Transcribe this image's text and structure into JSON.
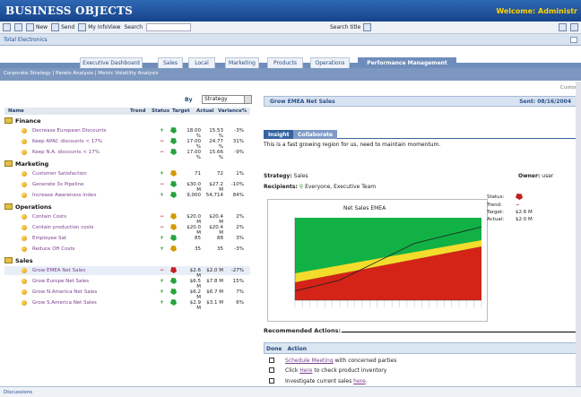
{
  "app": {
    "brand": "BUSINESS OBJECTS",
    "welcome": "Welcome: Administr"
  },
  "toolbar": {
    "new": "New",
    "send": "Send",
    "myinfoview": "My InfoView",
    "search": "Search",
    "searchtitle": "Search title"
  },
  "breadcrumb": "Total Electronics",
  "tabs": [
    "Executive Dashboard",
    "Sales",
    "Local",
    "Marketing",
    "Products",
    "Operations",
    "Performance Management"
  ],
  "subnav": "Corporate Strategy  |  Pareto Analysis  |  Metric Volatility Analysis",
  "customize": "Custom",
  "by": {
    "label": "By",
    "value": "Strategy"
  },
  "columns": {
    "name": "Name",
    "trend": "Trend",
    "status": "Status",
    "target": "Target",
    "actual": "Actual",
    "variance": "Variance%"
  },
  "categories": [
    {
      "name": "Finance",
      "items": [
        {
          "name": "Decrease European Discounts",
          "trend": "+",
          "status": "green",
          "target": "18.00 %",
          "actual": "15.53 %",
          "variance": "-3%"
        },
        {
          "name": "Keep APAC discounts < 17%",
          "trend": "−",
          "status": "green",
          "target": "17.00 %",
          "actual": "24.77 %",
          "variance": "31%"
        },
        {
          "name": "Keep N.A. discounts < 17%",
          "trend": "−",
          "status": "green",
          "target": "17.00 %",
          "actual": "15.66 %",
          "variance": "-9%"
        }
      ]
    },
    {
      "name": "Marketing",
      "items": [
        {
          "name": "Customer Satisfaction",
          "trend": "+",
          "status": "yellow",
          "target": "71",
          "actual": "72",
          "variance": "1%"
        },
        {
          "name": "Generate 3x Pipeline",
          "trend": "−",
          "status": "green",
          "target": "$30.0 M",
          "actual": "$27.2 M",
          "variance": "-10%"
        },
        {
          "name": "Increase Awareness Index",
          "trend": "+",
          "status": "green",
          "target": "9,000",
          "actual": "54,714",
          "variance": "84%"
        }
      ]
    },
    {
      "name": "Operations",
      "items": [
        {
          "name": "Contain Costs",
          "trend": "−",
          "status": "yellow",
          "target": "$20.0 M",
          "actual": "$20.4 M",
          "variance": "2%"
        },
        {
          "name": "Contain production costs",
          "trend": "−",
          "status": "yellow",
          "target": "$20.0 M",
          "actual": "$20.4 M",
          "variance": "2%"
        },
        {
          "name": "Employee Sat",
          "trend": "+",
          "status": "green",
          "target": "85",
          "actual": "88",
          "variance": "3%"
        },
        {
          "name": "Reduce OH Costs",
          "trend": "+",
          "status": "yellow",
          "target": "35",
          "actual": "35",
          "variance": "-3%"
        }
      ]
    },
    {
      "name": "Sales",
      "items": [
        {
          "name": "Grow EMEA Net Sales",
          "trend": "−",
          "status": "red",
          "target": "$2.6 M",
          "actual": "$2.0 M",
          "variance": "-27%"
        },
        {
          "name": "Grow Europe Net Sales",
          "trend": "+",
          "status": "green",
          "target": "$6.5 M",
          "actual": "$7.8 M",
          "variance": "15%"
        },
        {
          "name": "Grow N.America Net Sales",
          "trend": "+",
          "status": "green",
          "target": "$6.2 M",
          "actual": "$6.7 M",
          "variance": "7%"
        },
        {
          "name": "Grow S.America Net Sales",
          "trend": "+",
          "status": "green",
          "target": "$2.9 M",
          "actual": "$3.1 M",
          "variance": "6%"
        }
      ]
    }
  ],
  "detail": {
    "title": "Grow EMEA Net Sales",
    "sent": "Sent: 08/16/2004",
    "tabs": [
      "Insight",
      "Collaborate"
    ],
    "description": "This is a fast growing region for us, need to maintain momentum.",
    "strategy": "Strategy:",
    "strategy_value": "Sales",
    "owner": "Owner:",
    "owner_value": "user",
    "recipients": "Recipients:",
    "recipients_value": "Everyone, Executive Team",
    "chart_title": "Net Sales EMEA",
    "side": {
      "status": "Status:",
      "trend": "Trend:",
      "trend_value": "−",
      "target": "Target:",
      "target_value": "$2.6 M",
      "actual": "Actual:",
      "actual_value": "$2.0 M"
    },
    "recommended": "Recommended Actions:",
    "done": "Done",
    "action": "Action",
    "actions": [
      {
        "link": "Schedule Meeting",
        "rest": " with concerned parties"
      },
      {
        "pre": "Click ",
        "link": "Here",
        "rest": " to check product inventory"
      },
      {
        "pre": "Investigate current sales ",
        "link": "here",
        "rest": "."
      }
    ]
  },
  "bottom": "Discussions",
  "chart_data": {
    "type": "area",
    "title": "Net Sales EMEA",
    "zones": [
      "green",
      "yellow",
      "red"
    ],
    "series": [
      {
        "name": "Net Sales EMEA",
        "values": [
          6.0,
          6.1,
          6.2,
          6.3,
          6.4,
          6.5,
          6.6,
          6.8,
          7.0,
          7.2,
          7.4,
          7.6,
          7.8,
          8.0,
          8.2,
          8.4,
          8.6,
          8.7,
          8.8,
          8.9,
          9.0,
          9.1,
          9.2,
          9.3,
          9.4,
          9.5
        ]
      }
    ]
  }
}
